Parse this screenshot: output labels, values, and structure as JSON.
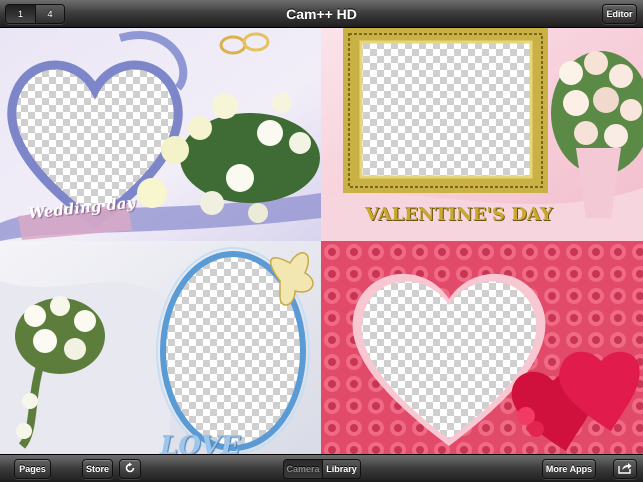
{
  "app": {
    "title": "Cam++ HD"
  },
  "top_bar": {
    "page_segments": [
      "1",
      "4"
    ],
    "editor_label": "Editor"
  },
  "bottom_bar": {
    "pages_label": "Pages",
    "store_label": "Store",
    "refresh_icon": "refresh-icon",
    "source_segments": [
      "Camera",
      "Library"
    ],
    "more_apps_label": "More Apps",
    "share_icon": "share-icon"
  },
  "frames": [
    {
      "name": "wedding-frame",
      "caption": "Wedding day",
      "window_shape": "heart"
    },
    {
      "name": "valentine-frame",
      "caption": "VALENTINE'S DAY",
      "window_shape": "rectangle"
    },
    {
      "name": "bouquet-oval-frame",
      "caption": "LOVE",
      "window_shape": "oval"
    },
    {
      "name": "rose-heart-frame",
      "caption": "",
      "window_shape": "heart"
    }
  ],
  "colors": {
    "toolbar_top": "#6e6e6e",
    "toolbar_bottom": "#1e1e1e",
    "ribbon_blue": "#7d86c9",
    "valentine_pink": "#f2c2d0",
    "gold_frame": "#b9a53a",
    "oval_blue": "#5a9bd6",
    "rose_red": "#e24a6a"
  }
}
